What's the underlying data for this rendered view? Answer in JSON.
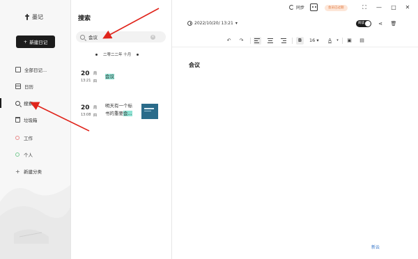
{
  "app": {
    "name": "墨记"
  },
  "sidebar": {
    "new_note_label": "新建日记",
    "nav": [
      {
        "label": "全部日记..."
      },
      {
        "label": "日历"
      },
      {
        "label": "搜索"
      },
      {
        "label": "垃圾箱"
      }
    ],
    "categories": [
      {
        "label": "工作",
        "color": "#e88a8a"
      },
      {
        "label": "个人",
        "color": "#7acb94"
      },
      {
        "label": "新建分类"
      }
    ]
  },
  "list": {
    "title": "搜索",
    "search_value": "会议",
    "date_header": "二零二二年 十月",
    "notes": [
      {
        "day": "20",
        "weekday": "周",
        "time": "13:21",
        "weekday2": "四",
        "text_hl": "会议"
      },
      {
        "day": "20",
        "weekday": "周",
        "time": "13:08",
        "weekday2": "四",
        "text_line1": "明天有一个标",
        "text_line2_a": "书的重要",
        "text_line2_hl": "会..."
      }
    ]
  },
  "editor": {
    "sync_label": "同步",
    "vip_label": "会员已过期",
    "datetime": "2022/10/20/ 13:21",
    "read_toggle": "阅读",
    "font_size": "16",
    "doc_title": "会议"
  },
  "watermark": "新云"
}
